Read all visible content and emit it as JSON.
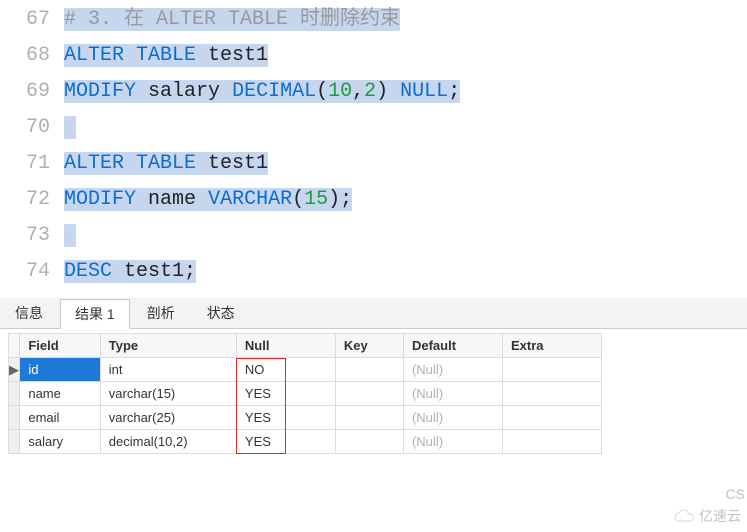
{
  "editor": {
    "lines": [
      {
        "n": "67",
        "tokens": [
          [
            "cm",
            "# 3. 在 ALTER TABLE 时删除约束"
          ]
        ],
        "hl": true
      },
      {
        "n": "68",
        "tokens": [
          [
            "kw",
            "ALTER TABLE"
          ],
          [
            "sp",
            " "
          ],
          [
            "id",
            "test1"
          ]
        ],
        "hl": true
      },
      {
        "n": "69",
        "tokens": [
          [
            "kw",
            "MODIFY"
          ],
          [
            "sp",
            " "
          ],
          [
            "id",
            "salary"
          ],
          [
            "sp",
            " "
          ],
          [
            "ty",
            "DECIMAL"
          ],
          [
            "pun",
            "("
          ],
          [
            "num",
            "10"
          ],
          [
            "pun",
            ","
          ],
          [
            "num",
            "2"
          ],
          [
            "pun",
            ")"
          ],
          [
            "sp",
            " "
          ],
          [
            "nn",
            "NULL"
          ],
          [
            "pun",
            ";"
          ]
        ],
        "hl": true
      },
      {
        "n": "70",
        "tokens": [],
        "hl": true,
        "blank": true
      },
      {
        "n": "71",
        "tokens": [
          [
            "kw",
            "ALTER TABLE"
          ],
          [
            "sp",
            " "
          ],
          [
            "id",
            "test1"
          ]
        ],
        "hl": true
      },
      {
        "n": "72",
        "tokens": [
          [
            "kw",
            "MODIFY"
          ],
          [
            "sp",
            " "
          ],
          [
            "id",
            "name"
          ],
          [
            "sp",
            " "
          ],
          [
            "ty",
            "VARCHAR"
          ],
          [
            "pun",
            "("
          ],
          [
            "num",
            "15"
          ],
          [
            "pun",
            ")"
          ],
          [
            "pun",
            ";"
          ]
        ],
        "hl": true
      },
      {
        "n": "73",
        "tokens": [],
        "hl": true,
        "blank": true
      },
      {
        "n": "74",
        "tokens": [
          [
            "kw",
            "DESC"
          ],
          [
            "sp",
            " "
          ],
          [
            "id",
            "test1"
          ],
          [
            "pun",
            ";"
          ]
        ],
        "hl": true
      }
    ]
  },
  "tabs": {
    "items": [
      "信息",
      "结果 1",
      "剖析",
      "状态"
    ],
    "active_index": 1
  },
  "table": {
    "headers": [
      "Field",
      "Type",
      "Null",
      "Key",
      "Default",
      "Extra"
    ],
    "rows": [
      {
        "indicator": "▶",
        "cells": [
          "id",
          "int",
          "NO",
          "",
          "(Null)",
          ""
        ],
        "selected_col": 0
      },
      {
        "indicator": "",
        "cells": [
          "name",
          "varchar(15)",
          "YES",
          "",
          "(Null)",
          ""
        ]
      },
      {
        "indicator": "",
        "cells": [
          "email",
          "varchar(25)",
          "YES",
          "",
          "(Null)",
          ""
        ]
      },
      {
        "indicator": "",
        "cells": [
          "salary",
          "decimal(10,2)",
          "YES",
          "",
          "(Null)",
          ""
        ]
      }
    ]
  },
  "watermark": {
    "text": "亿速云"
  },
  "cs": "CS"
}
